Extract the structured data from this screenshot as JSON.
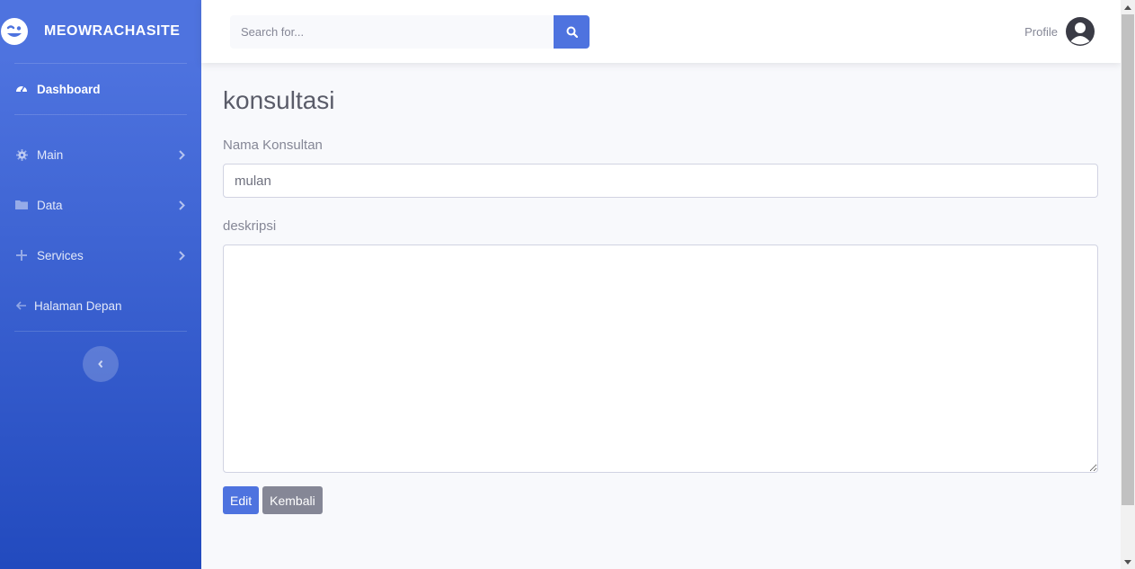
{
  "brand": {
    "name": "MEOWRACHASITE",
    "icon": "laugh-wink-icon"
  },
  "sidebar": {
    "items": [
      {
        "label": "Dashboard",
        "icon": "tachometer-icon",
        "active": true
      },
      {
        "label": "Main",
        "icon": "cog-icon",
        "has_submenu": true
      },
      {
        "label": "Data",
        "icon": "folder-icon",
        "has_submenu": true
      },
      {
        "label": "Services",
        "icon": "plus-icon",
        "has_submenu": true
      },
      {
        "label": "Halaman Depan",
        "icon": "arrow-left-icon"
      }
    ]
  },
  "topbar": {
    "search_placeholder": "Search for...",
    "profile_label": "Profile"
  },
  "main": {
    "title": "konsultasi",
    "fields": {
      "nama_label": "Nama Konsultan",
      "nama_value": "mulan",
      "deskripsi_label": "deskripsi",
      "deskripsi_value": ""
    },
    "buttons": {
      "edit": "Edit",
      "kembali": "Kembali"
    }
  },
  "colors": {
    "primary": "#4e73df",
    "secondary": "#858796",
    "sidebar_bottom": "#224abe"
  }
}
